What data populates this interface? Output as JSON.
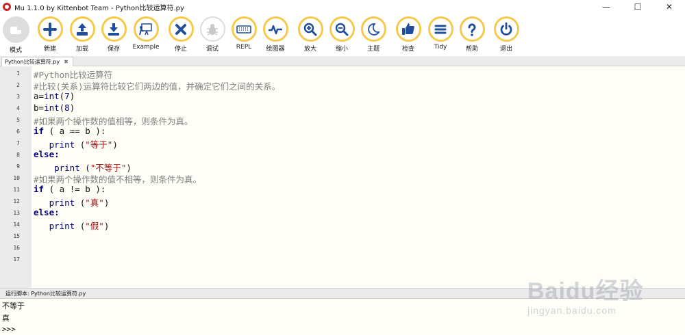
{
  "window": {
    "title": "Mu 1.1.0 by Kittenbot Team - Python比较运算符.py",
    "controls": {
      "minimize": "—",
      "maximize": "☐",
      "close": "✕"
    }
  },
  "toolbar": {
    "buttons": [
      {
        "label": "模式",
        "icon": "mode-icon"
      },
      {
        "label": "新建",
        "icon": "plus-icon"
      },
      {
        "label": "加载",
        "icon": "upload-icon"
      },
      {
        "label": "保存",
        "icon": "download-icon"
      },
      {
        "label": "Example",
        "icon": "presentation-icon"
      },
      {
        "label": "停止",
        "icon": "close-icon"
      },
      {
        "label": "调试",
        "icon": "bug-icon"
      },
      {
        "label": "REPL",
        "icon": "keyboard-icon"
      },
      {
        "label": "绘图器",
        "icon": "pulse-icon"
      },
      {
        "label": "放大",
        "icon": "zoom-in-icon"
      },
      {
        "label": "缩小",
        "icon": "zoom-out-icon"
      },
      {
        "label": "主题",
        "icon": "moon-icon"
      },
      {
        "label": "检查",
        "icon": "thumbs-up-icon"
      },
      {
        "label": "Tidy",
        "icon": "menu-lines-icon"
      },
      {
        "label": "帮助",
        "icon": "question-icon"
      },
      {
        "label": "退出",
        "icon": "power-icon"
      }
    ],
    "accent_color": "#f6c94b"
  },
  "tab": {
    "label": "Python比较运算符.py",
    "close": "✖"
  },
  "editor": {
    "line_numbers": [
      "1",
      "2",
      "3",
      "4",
      "5",
      "6",
      "7",
      "8",
      "9",
      "10",
      "11",
      "12",
      "13",
      "14",
      "15",
      "16",
      "17"
    ],
    "lines": {
      "l1": "#Python比较运算符",
      "l2": "#比较(关系)运算符比较它们两边的值，并确定它们之间的关系。",
      "l3_fn": "int",
      "l3_pre": "a=",
      "l3_arg": "7",
      "l4_fn": "int",
      "l4_pre": "b=",
      "l4_arg": "8",
      "l5": "#如果两个操作数的值相等，则条件为真。",
      "l6_kw": "if",
      "l6_rest": " ( a == b ):",
      "l7_fn": "print",
      "l7_str": "\"等于\"",
      "l8_kw": "else:",
      "l9_fn": "print",
      "l9_str": "\"不等于\"",
      "l10": "#如果两个操作数的值不相等，则条件为真。",
      "l11_kw": "if",
      "l11_rest": " ( a != b ):",
      "l12_fn": "print",
      "l12_str": "\"真\"",
      "l13_kw": "else:",
      "l14_fn": "print",
      "l14_str": "\"假\""
    }
  },
  "runner": {
    "label": "运行脚本: Python比较运算符.py",
    "output": [
      "不等于",
      "真",
      ">>>"
    ]
  },
  "watermark": {
    "text": "Baidu经验",
    "sub": "jingyan.baidu.com"
  }
}
